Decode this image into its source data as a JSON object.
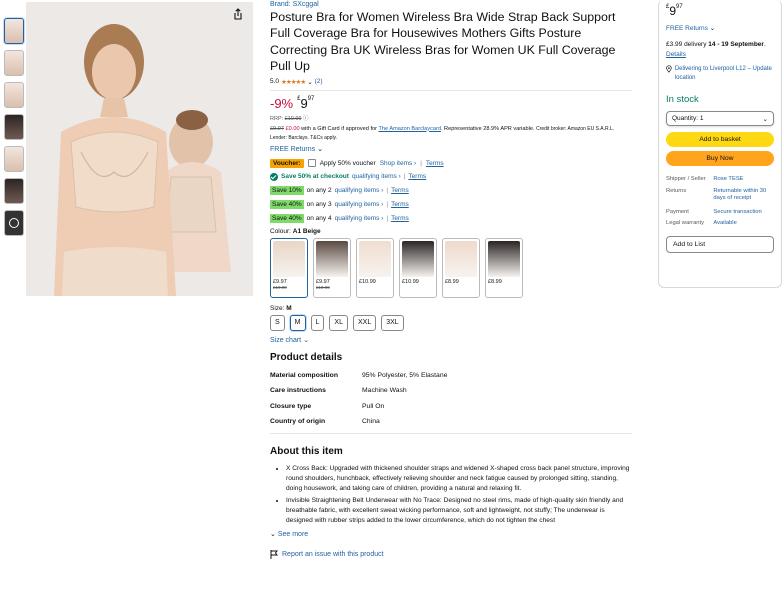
{
  "product": {
    "brand": "Brand: SXcggal",
    "title": "Posture Bra for Women Wireless Bra Wide Strap Back Support Full Coverage Bra for Housewives Mothers Gifts Posture Correcting Bra UK Wireless Bras for Women UK Full Coverage Pull Up",
    "rating_value": "5.0",
    "rating_stars": "★★★★★",
    "rating_count": "(2)"
  },
  "pricing": {
    "discount": "-9%",
    "currency": "£",
    "whole": "9",
    "fraction": "97",
    "rrp_label": "RRP:",
    "rrp_value": "£10.99",
    "gift_old": "£9.97",
    "gift_new": "£0.00",
    "gift_text": "with a Gift Card if approved for",
    "gift_link": "The Amazon Barclaycard",
    "gift_tail": ". Representative 28.9% APR variable.",
    "gift_small": "Credit broker: Amazon EU S.A.R.L. Lender: Barclays. T&Cs apply.",
    "free_returns": "FREE Returns"
  },
  "promos": {
    "voucher_badge": "Voucher:",
    "voucher_text": "Apply 50% voucher",
    "shop_items": "Shop items ›",
    "terms": "Terms",
    "checkout_text": "Save 50% at checkout",
    "qualifying": "qualifying items ›",
    "tiers": [
      {
        "badge": "Save 10%",
        "text": "on any 2"
      },
      {
        "badge": "Save 40%",
        "text": "on any 3"
      },
      {
        "badge": "Save 40%",
        "text": "on any 4"
      }
    ]
  },
  "colour": {
    "label": "Colour:",
    "selected": "A1 Beige",
    "swatches": [
      {
        "price": "£9.97",
        "old": "£10.99",
        "tone": "#e8d6c6"
      },
      {
        "price": "£9.97",
        "old": "£10.99",
        "tone": "#5a4a43"
      },
      {
        "price": "£10.99",
        "old": "",
        "tone": "#f0ddd0"
      },
      {
        "price": "£10.99",
        "old": "",
        "tone": "#2b2626"
      },
      {
        "price": "£8.99",
        "old": "",
        "tone": "#efd9cb"
      },
      {
        "price": "£8.99",
        "old": "",
        "tone": "#2a2424"
      }
    ]
  },
  "size": {
    "label": "Size:",
    "selected": "M",
    "options": [
      "S",
      "M",
      "L",
      "XL",
      "XXL",
      "3XL"
    ],
    "chart_link": "Size chart"
  },
  "details": {
    "title": "Product details",
    "rows": [
      {
        "k": "Material composition",
        "v": "95% Polyester, 5% Elastane"
      },
      {
        "k": "Care instructions",
        "v": "Machine Wash"
      },
      {
        "k": "Closure type",
        "v": "Pull On"
      },
      {
        "k": "Country of origin",
        "v": "China"
      }
    ]
  },
  "about": {
    "title": "About this item",
    "bullets": [
      "X Cross Back: Upgraded with thickened shoulder straps and widened X-shaped cross back panel structure, improving round shoulders, hunchback, effectively relieving shoulder and neck fatigue caused by prolonged sitting, standing, doing housework, and taking care of children, providing a natural and relaxing fit.",
      "Invisible Straightening Belt Underwear with No Trace: Designed no steel rims, made of high-quality skin friendly and breathable fabric, with excellent sweat wicking performance, soft and lightweight, not stuffy; The underwear is designed with rubber strips added to the lower circumference, which do not tighten the chest"
    ],
    "see_more": "See more",
    "report": "Report an issue with this product"
  },
  "buybox": {
    "currency": "£",
    "whole": "9",
    "fraction": "97",
    "free_returns": "FREE Returns",
    "delivery_pre": "£3.99 delivery",
    "delivery_date": "14 - 19 September",
    "details_link": "Details",
    "location": "Delivering to Liverpool L12 – Update location",
    "stock": "In stock",
    "quantity": "Quantity: 1",
    "add_basket": "Add to basket",
    "buy_now": "Buy Now",
    "info": [
      {
        "k": "Shipper / Seller",
        "v": "Rose TESE"
      },
      {
        "k": "Returns",
        "v": "Returnable within 30 days of receipt"
      },
      {
        "k": "Payment",
        "v": "Secure transaction"
      },
      {
        "k": "Legal warranty",
        "v": "Available"
      }
    ],
    "add_list": "Add to List"
  },
  "colors": {
    "link": "#2162a1",
    "deal_red": "#cc0c39",
    "green": "#067d62",
    "basket_yellow": "#ffd814",
    "buy_orange": "#ffa41c"
  }
}
